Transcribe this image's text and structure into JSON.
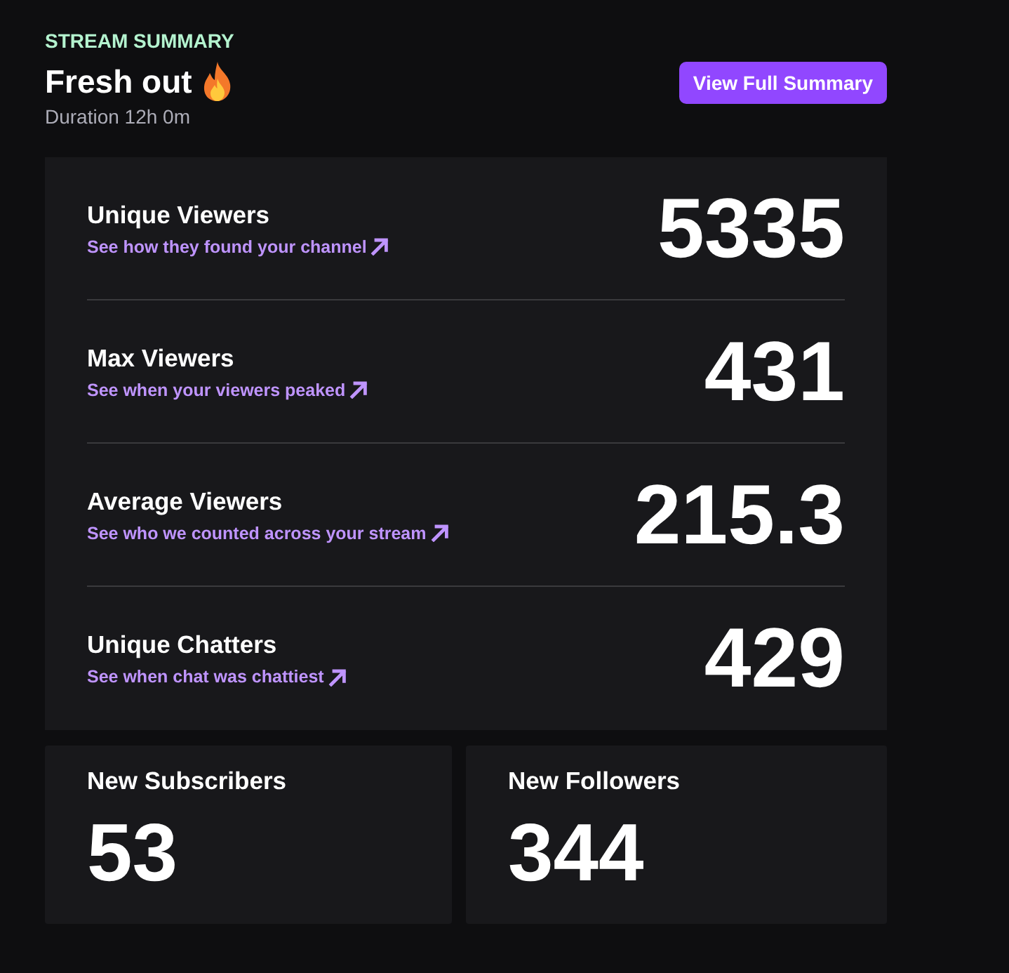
{
  "header": {
    "eyebrow": "STREAM SUMMARY",
    "title": "Fresh out",
    "duration": "Duration 12h 0m",
    "button": "View Full Summary"
  },
  "metrics": [
    {
      "label": "Unique Viewers",
      "link": "See how they found your channel",
      "value": "5335"
    },
    {
      "label": "Max Viewers",
      "link": "See when your viewers peaked",
      "value": "431"
    },
    {
      "label": "Average Viewers",
      "link": "See who we counted across your stream",
      "value": "215.3"
    },
    {
      "label": "Unique Chatters",
      "link": "See when chat was chattiest",
      "value": "429"
    }
  ],
  "cards": [
    {
      "label": "New Subscribers",
      "value": "53"
    },
    {
      "label": "New Followers",
      "value": "344"
    }
  ]
}
